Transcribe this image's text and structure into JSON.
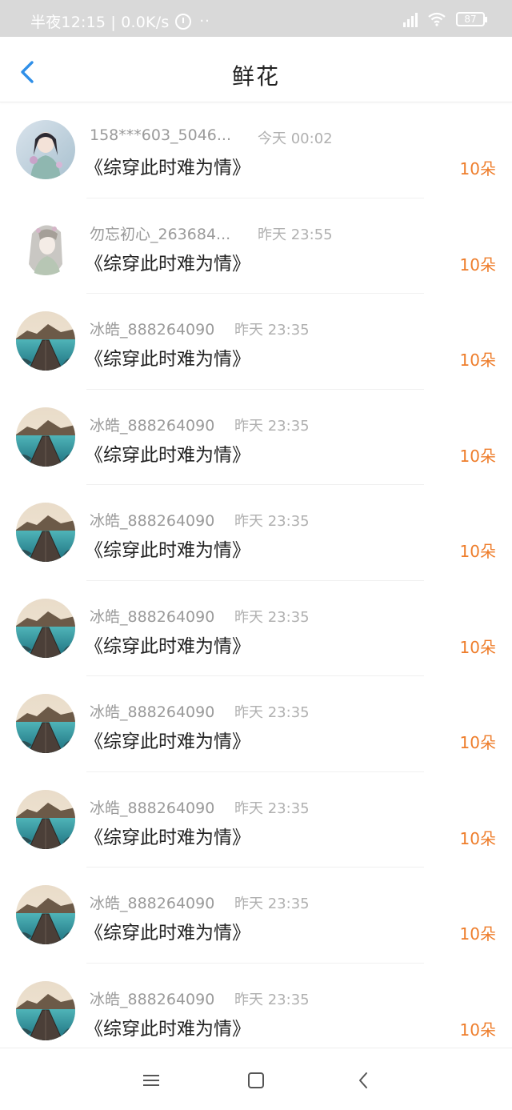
{
  "status_bar": {
    "time_text": "半夜12:15 | 0.0K/s",
    "dots": "··",
    "battery": "87"
  },
  "header": {
    "title": "鲜花"
  },
  "items": [
    {
      "name": "158***603_5046...",
      "time": "今天 00:02",
      "book": "《综穿此时难为情》",
      "amount": "10朵",
      "avatar": "girl-portrait"
    },
    {
      "name": "勿忘初心_263684...",
      "time": "昨天 23:55",
      "book": "《综穿此时难为情》",
      "amount": "10朵",
      "avatar": "anime-girl"
    },
    {
      "name": "冰皓_888264090",
      "time": "昨天 23:35",
      "book": "《综穿此时难为情》",
      "amount": "10朵",
      "avatar": "lake-pier"
    },
    {
      "name": "冰皓_888264090",
      "time": "昨天 23:35",
      "book": "《综穿此时难为情》",
      "amount": "10朵",
      "avatar": "lake-pier"
    },
    {
      "name": "冰皓_888264090",
      "time": "昨天 23:35",
      "book": "《综穿此时难为情》",
      "amount": "10朵",
      "avatar": "lake-pier"
    },
    {
      "name": "冰皓_888264090",
      "time": "昨天 23:35",
      "book": "《综穿此时难为情》",
      "amount": "10朵",
      "avatar": "lake-pier"
    },
    {
      "name": "冰皓_888264090",
      "time": "昨天 23:35",
      "book": "《综穿此时难为情》",
      "amount": "10朵",
      "avatar": "lake-pier"
    },
    {
      "name": "冰皓_888264090",
      "time": "昨天 23:35",
      "book": "《综穿此时难为情》",
      "amount": "10朵",
      "avatar": "lake-pier"
    },
    {
      "name": "冰皓_888264090",
      "time": "昨天 23:35",
      "book": "《综穿此时难为情》",
      "amount": "10朵",
      "avatar": "lake-pier"
    },
    {
      "name": "冰皓_888264090",
      "time": "昨天 23:35",
      "book": "《综穿此时难为情》",
      "amount": "10朵",
      "avatar": "lake-pier"
    }
  ],
  "colors": {
    "accent": "#2f8fe8",
    "amount": "#ee7d2b",
    "statusbar": "#d9d9d9"
  },
  "nav_icons": [
    "menu-icon",
    "home-square-icon",
    "back-triangle-icon"
  ]
}
